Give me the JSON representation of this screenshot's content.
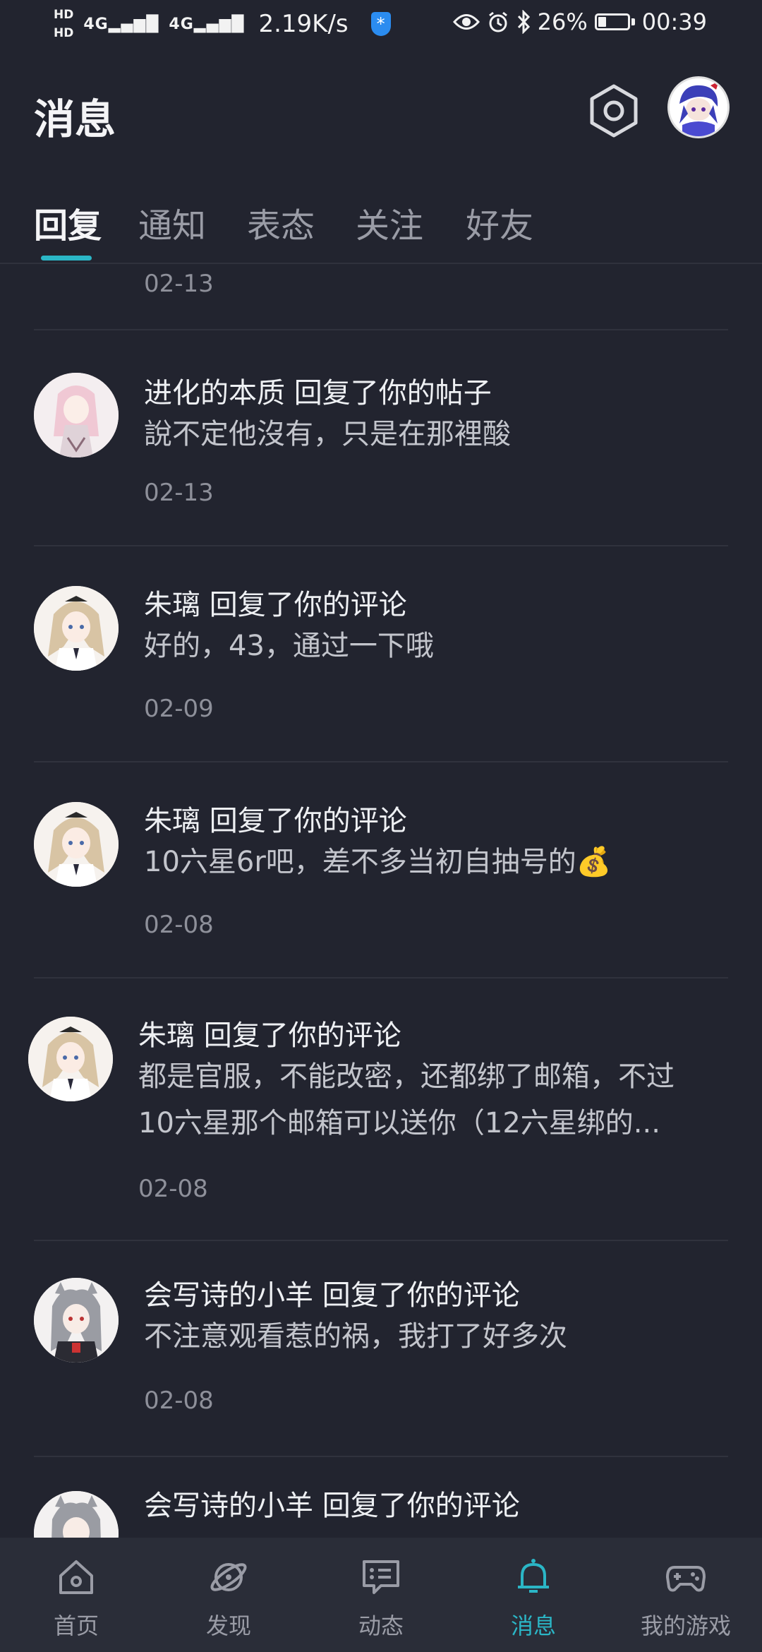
{
  "status_bar": {
    "hd1": "HD",
    "hd2": "HD",
    "signal1": "4G",
    "signal2": "4G",
    "net_speed": "2.19K/s",
    "battery_pct": "26%",
    "battery_level": 0.26,
    "time": "00:39"
  },
  "header": {
    "title": "消息",
    "settings_icon": "settings-hexagon-icon"
  },
  "tabs": [
    {
      "label": "回复",
      "active": true
    },
    {
      "label": "通知"
    },
    {
      "label": "表态"
    },
    {
      "label": "关注"
    },
    {
      "label": "好友"
    }
  ],
  "list": {
    "top_date": "02-13",
    "items": [
      {
        "title": "进化的本质 回复了你的帖子",
        "body": "說不定他沒有，只是在那裡酸",
        "date": "02-13"
      },
      {
        "title": "朱璃 回复了你的评论",
        "body": "好的，43，通过一下哦",
        "date": "02-09"
      },
      {
        "title": "朱璃 回复了你的评论",
        "body": "10六星6r吧，差不多当初自抽号的💰",
        "date": "02-08"
      },
      {
        "title": "朱璃 回复了你的评论",
        "body_line1": "都是官服，不能改密，还都绑了邮箱，不过",
        "body_line2": "10六星那个邮箱可以送你（12六星绑的...",
        "date": "02-08"
      },
      {
        "title": "会写诗的小羊 回复了你的评论",
        "body": "不注意观看惹的祸，我打了好多次",
        "date": "02-08"
      },
      {
        "title": "会写诗的小羊 回复了你的评论"
      }
    ]
  },
  "bottom_nav": [
    {
      "label": "首页",
      "icon": "home-icon"
    },
    {
      "label": "发现",
      "icon": "planet-icon"
    },
    {
      "label": "动态",
      "icon": "message-board-icon"
    },
    {
      "label": "消息",
      "icon": "bell-icon",
      "active": true
    },
    {
      "label": "我的游戏",
      "icon": "gamepad-icon"
    }
  ],
  "colors": {
    "background": "#22242f",
    "accent": "#2bb6c6",
    "nav_bg": "#2a2d38"
  }
}
